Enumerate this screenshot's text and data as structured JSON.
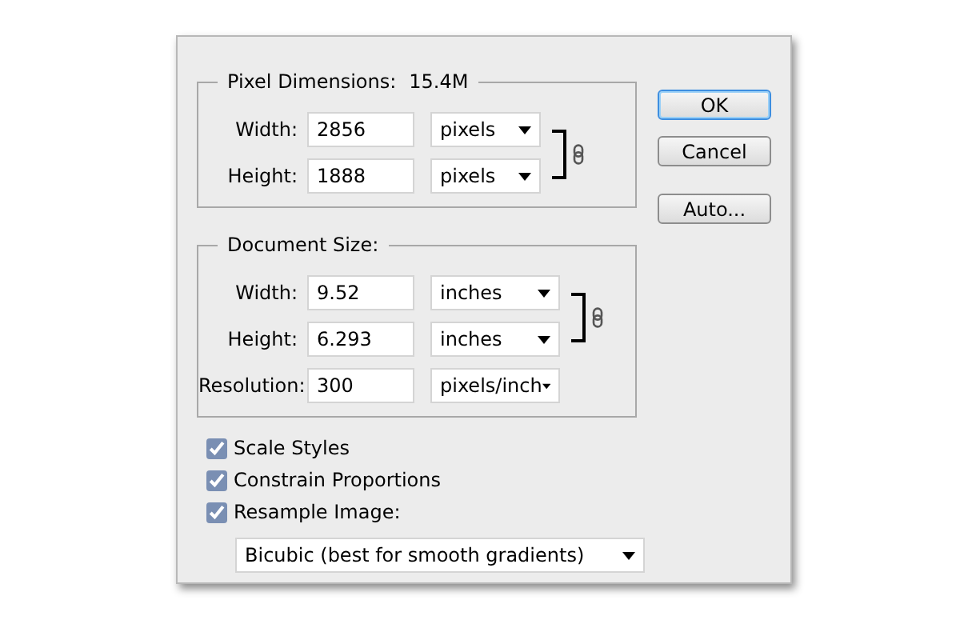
{
  "groups": [
    {
      "title": "Pixel Dimensions:",
      "value": "15.4M",
      "fields": [
        {
          "label": "Width:",
          "value": "2856",
          "unit": "pixels",
          "linked": true
        },
        {
          "label": "Height:",
          "value": "1888",
          "unit": "pixels",
          "linked": true
        }
      ]
    },
    {
      "title": "Document Size:",
      "fields": [
        {
          "label": "Width:",
          "value": "9.52",
          "unit": "inches",
          "linked": true
        },
        {
          "label": "Height:",
          "value": "6.293",
          "unit": "inches",
          "linked": true
        },
        {
          "label": "Resolution:",
          "value": "300",
          "unit": "pixels/inch",
          "linked": false
        }
      ]
    }
  ],
  "options": [
    {
      "label": "Scale Styles",
      "checked": true
    },
    {
      "label": "Constrain Proportions",
      "checked": true
    },
    {
      "label": "Resample Image:",
      "checked": true
    }
  ],
  "method": "Bicubic (best for smooth gradients)",
  "buttons": [
    {
      "label": "OK",
      "default": true
    },
    {
      "label": "Cancel",
      "default": false
    },
    {
      "label": "Auto...",
      "default": false
    }
  ]
}
